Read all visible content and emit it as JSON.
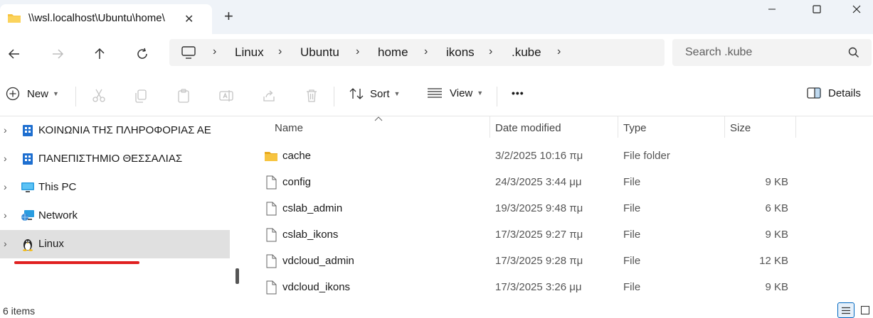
{
  "titlebar": {
    "tab_title": "\\\\wsl.localhost\\Ubuntu\\home\\",
    "close_glyph": "✕",
    "newtab_glyph": "+"
  },
  "address": {
    "breadcrumbs": [
      "Linux",
      "Ubuntu",
      "home",
      "ikons",
      ".kube"
    ],
    "separator": "›",
    "search_placeholder": "Search .kube"
  },
  "commandbar": {
    "new_label": "New",
    "sort_label": "Sort",
    "view_label": "View",
    "more_label": "•••",
    "details_label": "Details"
  },
  "navpane": {
    "items": [
      {
        "label": "ΚΟΙΝΩΝΙΑ ΤΗΣ ΠΛΗΡΟΦΟΡΙΑΣ ΑΕ",
        "icon": "building-icon"
      },
      {
        "label": "ΠΑΝΕΠΙΣΤΗΜΙΟ ΘΕΣΣΑΛΙΑΣ",
        "icon": "building-icon"
      },
      {
        "label": "This PC",
        "icon": "monitor-icon"
      },
      {
        "label": "Network",
        "icon": "network-icon"
      },
      {
        "label": "Linux",
        "icon": "linux-penguin-icon"
      }
    ],
    "chevron": "›"
  },
  "content": {
    "columns": {
      "name": "Name",
      "date": "Date modified",
      "type": "Type",
      "size": "Size"
    },
    "files": [
      {
        "name": "cache",
        "date": "3/2/2025 10:16 πμ",
        "type": "File folder",
        "size": "",
        "icon": "folder-icon"
      },
      {
        "name": "config",
        "date": "24/3/2025 3:44 μμ",
        "type": "File",
        "size": "9 KB",
        "icon": "file-icon"
      },
      {
        "name": "cslab_admin",
        "date": "19/3/2025 9:48 πμ",
        "type": "File",
        "size": "6 KB",
        "icon": "file-icon"
      },
      {
        "name": "cslab_ikons",
        "date": "17/3/2025 9:27 πμ",
        "type": "File",
        "size": "9 KB",
        "icon": "file-icon"
      },
      {
        "name": "vdcloud_admin",
        "date": "17/3/2025 9:28 πμ",
        "type": "File",
        "size": "12 KB",
        "icon": "file-icon"
      },
      {
        "name": "vdcloud_ikons",
        "date": "17/3/2025 3:26 μμ",
        "type": "File",
        "size": "9 KB",
        "icon": "file-icon"
      }
    ]
  },
  "status": {
    "items_text": "6 items"
  },
  "colors": {
    "accent": "#0067c0",
    "folder": "#f7c440",
    "selection": "#e0e0e0",
    "annotation": "#e02020"
  }
}
